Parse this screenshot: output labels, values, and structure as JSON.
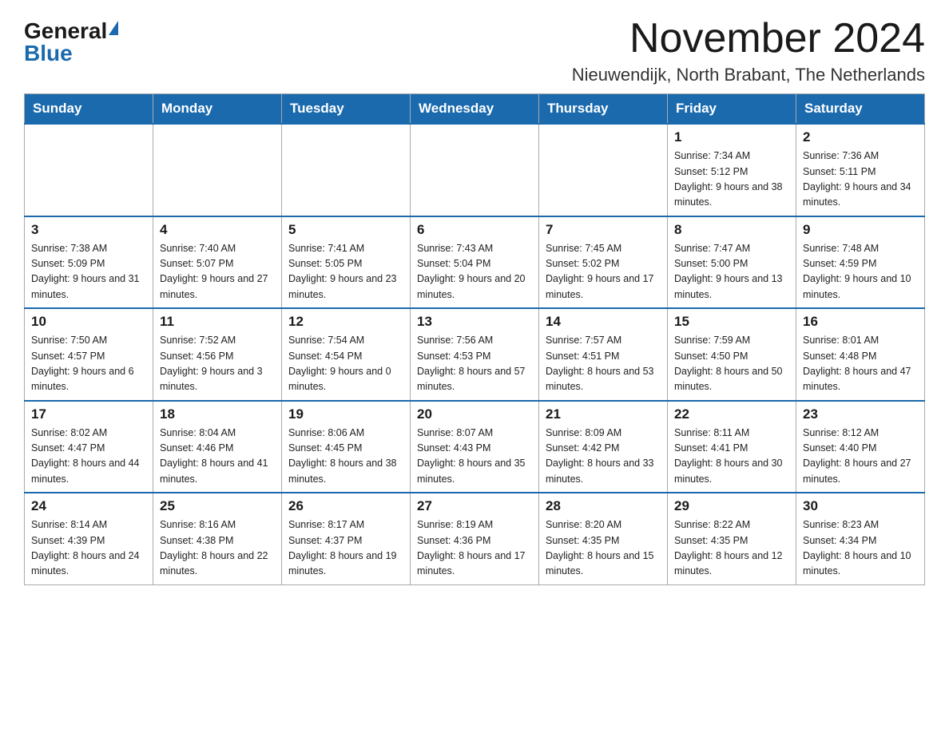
{
  "logo": {
    "general": "General",
    "blue": "Blue"
  },
  "title": {
    "month_year": "November 2024",
    "location": "Nieuwendijk, North Brabant, The Netherlands"
  },
  "days_header": [
    "Sunday",
    "Monday",
    "Tuesday",
    "Wednesday",
    "Thursday",
    "Friday",
    "Saturday"
  ],
  "weeks": [
    [
      {
        "day": "",
        "sunrise": "",
        "sunset": "",
        "daylight": ""
      },
      {
        "day": "",
        "sunrise": "",
        "sunset": "",
        "daylight": ""
      },
      {
        "day": "",
        "sunrise": "",
        "sunset": "",
        "daylight": ""
      },
      {
        "day": "",
        "sunrise": "",
        "sunset": "",
        "daylight": ""
      },
      {
        "day": "",
        "sunrise": "",
        "sunset": "",
        "daylight": ""
      },
      {
        "day": "1",
        "sunrise": "Sunrise: 7:34 AM",
        "sunset": "Sunset: 5:12 PM",
        "daylight": "Daylight: 9 hours and 38 minutes."
      },
      {
        "day": "2",
        "sunrise": "Sunrise: 7:36 AM",
        "sunset": "Sunset: 5:11 PM",
        "daylight": "Daylight: 9 hours and 34 minutes."
      }
    ],
    [
      {
        "day": "3",
        "sunrise": "Sunrise: 7:38 AM",
        "sunset": "Sunset: 5:09 PM",
        "daylight": "Daylight: 9 hours and 31 minutes."
      },
      {
        "day": "4",
        "sunrise": "Sunrise: 7:40 AM",
        "sunset": "Sunset: 5:07 PM",
        "daylight": "Daylight: 9 hours and 27 minutes."
      },
      {
        "day": "5",
        "sunrise": "Sunrise: 7:41 AM",
        "sunset": "Sunset: 5:05 PM",
        "daylight": "Daylight: 9 hours and 23 minutes."
      },
      {
        "day": "6",
        "sunrise": "Sunrise: 7:43 AM",
        "sunset": "Sunset: 5:04 PM",
        "daylight": "Daylight: 9 hours and 20 minutes."
      },
      {
        "day": "7",
        "sunrise": "Sunrise: 7:45 AM",
        "sunset": "Sunset: 5:02 PM",
        "daylight": "Daylight: 9 hours and 17 minutes."
      },
      {
        "day": "8",
        "sunrise": "Sunrise: 7:47 AM",
        "sunset": "Sunset: 5:00 PM",
        "daylight": "Daylight: 9 hours and 13 minutes."
      },
      {
        "day": "9",
        "sunrise": "Sunrise: 7:48 AM",
        "sunset": "Sunset: 4:59 PM",
        "daylight": "Daylight: 9 hours and 10 minutes."
      }
    ],
    [
      {
        "day": "10",
        "sunrise": "Sunrise: 7:50 AM",
        "sunset": "Sunset: 4:57 PM",
        "daylight": "Daylight: 9 hours and 6 minutes."
      },
      {
        "day": "11",
        "sunrise": "Sunrise: 7:52 AM",
        "sunset": "Sunset: 4:56 PM",
        "daylight": "Daylight: 9 hours and 3 minutes."
      },
      {
        "day": "12",
        "sunrise": "Sunrise: 7:54 AM",
        "sunset": "Sunset: 4:54 PM",
        "daylight": "Daylight: 9 hours and 0 minutes."
      },
      {
        "day": "13",
        "sunrise": "Sunrise: 7:56 AM",
        "sunset": "Sunset: 4:53 PM",
        "daylight": "Daylight: 8 hours and 57 minutes."
      },
      {
        "day": "14",
        "sunrise": "Sunrise: 7:57 AM",
        "sunset": "Sunset: 4:51 PM",
        "daylight": "Daylight: 8 hours and 53 minutes."
      },
      {
        "day": "15",
        "sunrise": "Sunrise: 7:59 AM",
        "sunset": "Sunset: 4:50 PM",
        "daylight": "Daylight: 8 hours and 50 minutes."
      },
      {
        "day": "16",
        "sunrise": "Sunrise: 8:01 AM",
        "sunset": "Sunset: 4:48 PM",
        "daylight": "Daylight: 8 hours and 47 minutes."
      }
    ],
    [
      {
        "day": "17",
        "sunrise": "Sunrise: 8:02 AM",
        "sunset": "Sunset: 4:47 PM",
        "daylight": "Daylight: 8 hours and 44 minutes."
      },
      {
        "day": "18",
        "sunrise": "Sunrise: 8:04 AM",
        "sunset": "Sunset: 4:46 PM",
        "daylight": "Daylight: 8 hours and 41 minutes."
      },
      {
        "day": "19",
        "sunrise": "Sunrise: 8:06 AM",
        "sunset": "Sunset: 4:45 PM",
        "daylight": "Daylight: 8 hours and 38 minutes."
      },
      {
        "day": "20",
        "sunrise": "Sunrise: 8:07 AM",
        "sunset": "Sunset: 4:43 PM",
        "daylight": "Daylight: 8 hours and 35 minutes."
      },
      {
        "day": "21",
        "sunrise": "Sunrise: 8:09 AM",
        "sunset": "Sunset: 4:42 PM",
        "daylight": "Daylight: 8 hours and 33 minutes."
      },
      {
        "day": "22",
        "sunrise": "Sunrise: 8:11 AM",
        "sunset": "Sunset: 4:41 PM",
        "daylight": "Daylight: 8 hours and 30 minutes."
      },
      {
        "day": "23",
        "sunrise": "Sunrise: 8:12 AM",
        "sunset": "Sunset: 4:40 PM",
        "daylight": "Daylight: 8 hours and 27 minutes."
      }
    ],
    [
      {
        "day": "24",
        "sunrise": "Sunrise: 8:14 AM",
        "sunset": "Sunset: 4:39 PM",
        "daylight": "Daylight: 8 hours and 24 minutes."
      },
      {
        "day": "25",
        "sunrise": "Sunrise: 8:16 AM",
        "sunset": "Sunset: 4:38 PM",
        "daylight": "Daylight: 8 hours and 22 minutes."
      },
      {
        "day": "26",
        "sunrise": "Sunrise: 8:17 AM",
        "sunset": "Sunset: 4:37 PM",
        "daylight": "Daylight: 8 hours and 19 minutes."
      },
      {
        "day": "27",
        "sunrise": "Sunrise: 8:19 AM",
        "sunset": "Sunset: 4:36 PM",
        "daylight": "Daylight: 8 hours and 17 minutes."
      },
      {
        "day": "28",
        "sunrise": "Sunrise: 8:20 AM",
        "sunset": "Sunset: 4:35 PM",
        "daylight": "Daylight: 8 hours and 15 minutes."
      },
      {
        "day": "29",
        "sunrise": "Sunrise: 8:22 AM",
        "sunset": "Sunset: 4:35 PM",
        "daylight": "Daylight: 8 hours and 12 minutes."
      },
      {
        "day": "30",
        "sunrise": "Sunrise: 8:23 AM",
        "sunset": "Sunset: 4:34 PM",
        "daylight": "Daylight: 8 hours and 10 minutes."
      }
    ]
  ]
}
